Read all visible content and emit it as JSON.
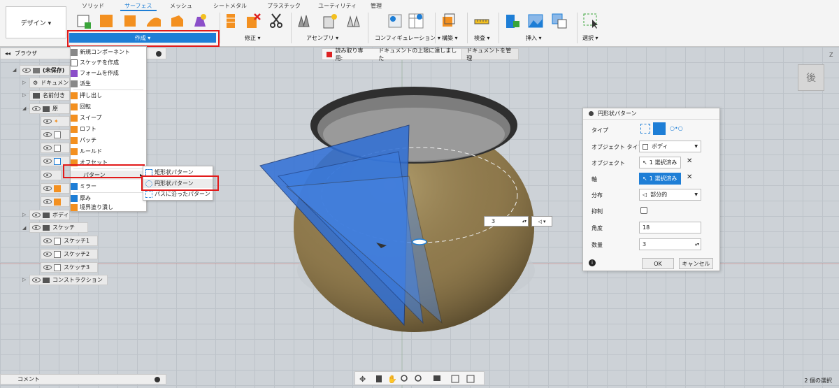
{
  "toolbar": {
    "design_label": "デザイン ▾",
    "tabs": [
      "ソリッド",
      "サーフェス",
      "メッシュ",
      "シートメタル",
      "プラスチック",
      "ユーティリティ",
      "管理"
    ],
    "active_tab": "サーフェス",
    "create_label": "作成 ▾",
    "groups": [
      "修正 ▾",
      "アセンブリ ▾",
      "コンフィギュレーション ▾",
      "構築 ▾",
      "検査 ▾",
      "挿入 ▾",
      "選択 ▾"
    ]
  },
  "browser": {
    "title": "ブラウザ",
    "rows": [
      "(未保存)",
      "ドキュメント",
      "名前付き",
      "原",
      "ボディ",
      "スケッチ",
      "スケッチ1",
      "スケッチ2",
      "スケッチ3",
      "コンストラクション"
    ]
  },
  "readonly": {
    "label": "読み取り専用:",
    "message": "ドキュメントの上限に達しました",
    "manage": "ドキュメントを管理"
  },
  "create_menu": {
    "items": [
      "新規コンポーネント",
      "スケッチを作成",
      "フォームを作成",
      "派生",
      "押し出し",
      "回転",
      "スイープ",
      "ロフト",
      "パッチ",
      "ルールド",
      "オフセット",
      "パターン",
      "ミラー",
      "厚み",
      "境界塗り潰し"
    ]
  },
  "pattern_menu": {
    "items": [
      "矩形状パターン",
      "円形状パターン",
      "パスに沿ったパターン"
    ]
  },
  "dialog": {
    "title": "円形状パターン",
    "type_label": "タイプ",
    "object_type_label": "オブジェクト タイプ",
    "object_type_value": "ボディ",
    "objects_label": "オブジェクト",
    "objects_value": "1 選択済み",
    "axis_label": "軸",
    "axis_value": "1 選択済み",
    "distribution_label": "分布",
    "distribution_value": "部分的",
    "suppress_label": "抑制",
    "angle_label": "角度",
    "angle_value": "18",
    "quantity_label": "数量",
    "quantity_value": "3",
    "ok": "OK",
    "cancel": "キャンセル",
    "clear": "✕",
    "info": "i"
  },
  "count_input": "3",
  "viewcube": {
    "face": "後",
    "axis_label": "Z"
  },
  "comment": "コメント",
  "status": "2 個の選択"
}
